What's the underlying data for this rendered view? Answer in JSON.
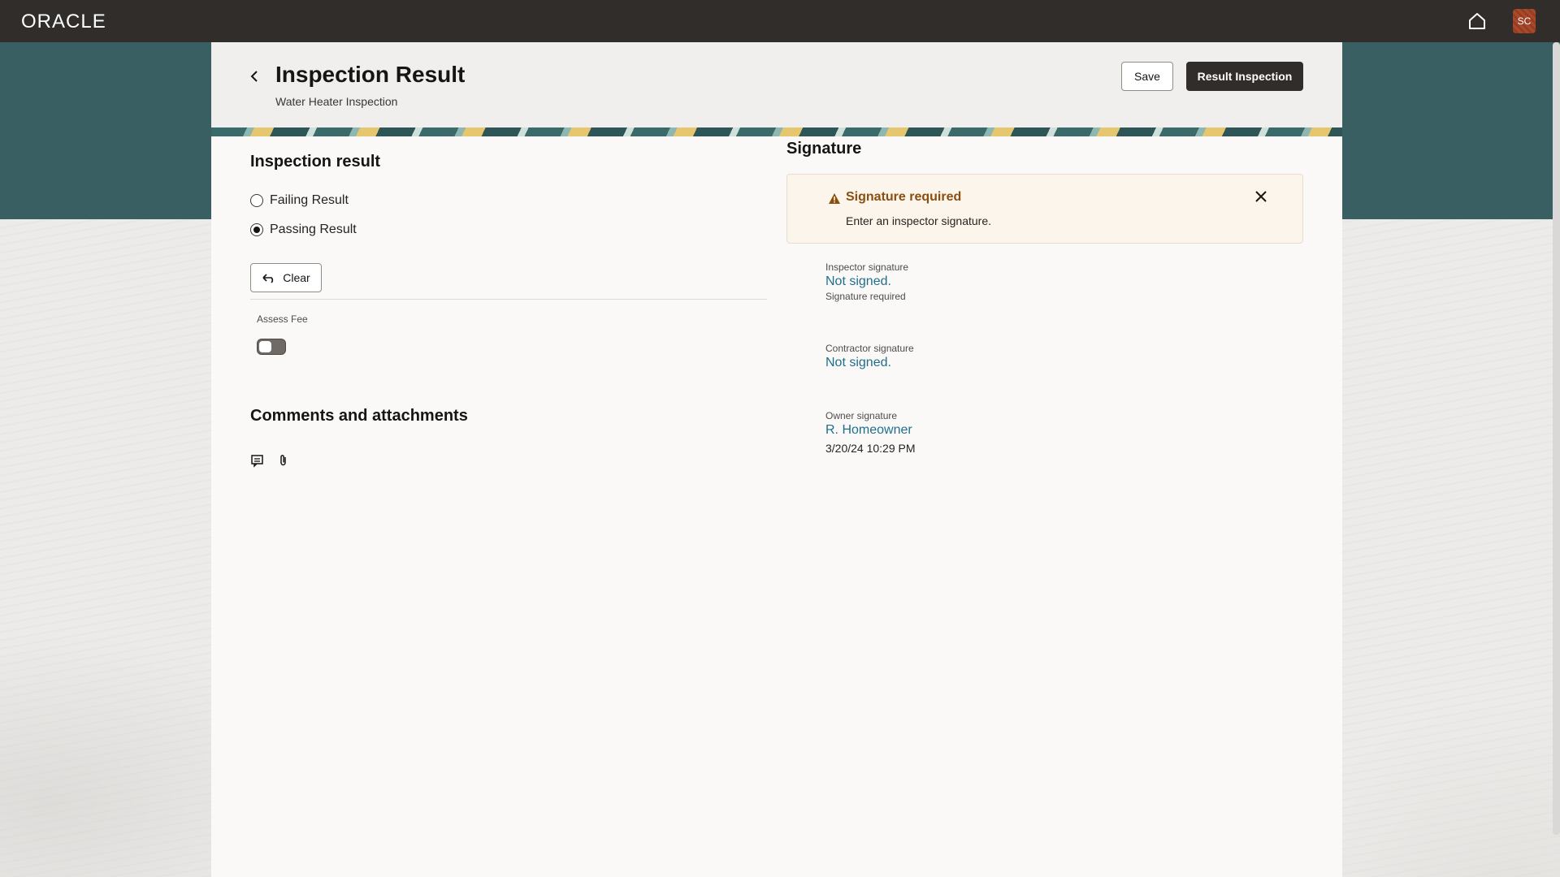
{
  "topbar": {
    "brand": "ORACLE",
    "avatar_initials": "SC"
  },
  "header": {
    "title": "Inspection Result",
    "subtitle": "Water Heater Inspection",
    "save_label": "Save",
    "result_label": "Result Inspection"
  },
  "inspection_result": {
    "title": "Inspection result",
    "options": [
      {
        "label": "Failing Result",
        "selected": false
      },
      {
        "label": "Passing Result",
        "selected": true
      }
    ],
    "clear_label": "Clear",
    "assess_fee_label": "Assess Fee",
    "assess_fee_on": false
  },
  "comments": {
    "title": "Comments and attachments"
  },
  "signature": {
    "title": "Signature",
    "alert_title": "Signature required",
    "alert_text": "Enter an inspector signature.",
    "inspector_label": "Inspector signature",
    "inspector_value": "Not signed.",
    "inspector_hint": "Signature required",
    "contractor_label": "Contractor signature",
    "contractor_value": "Not signed.",
    "owner_label": "Owner signature",
    "owner_value": "R. Homeowner",
    "owner_date": "3/20/24 10:29 PM"
  },
  "colors": {
    "topbar": "#312d2a",
    "teal": "#3a5f62",
    "link": "#1f6f8b",
    "warning": "#8a4f10"
  }
}
